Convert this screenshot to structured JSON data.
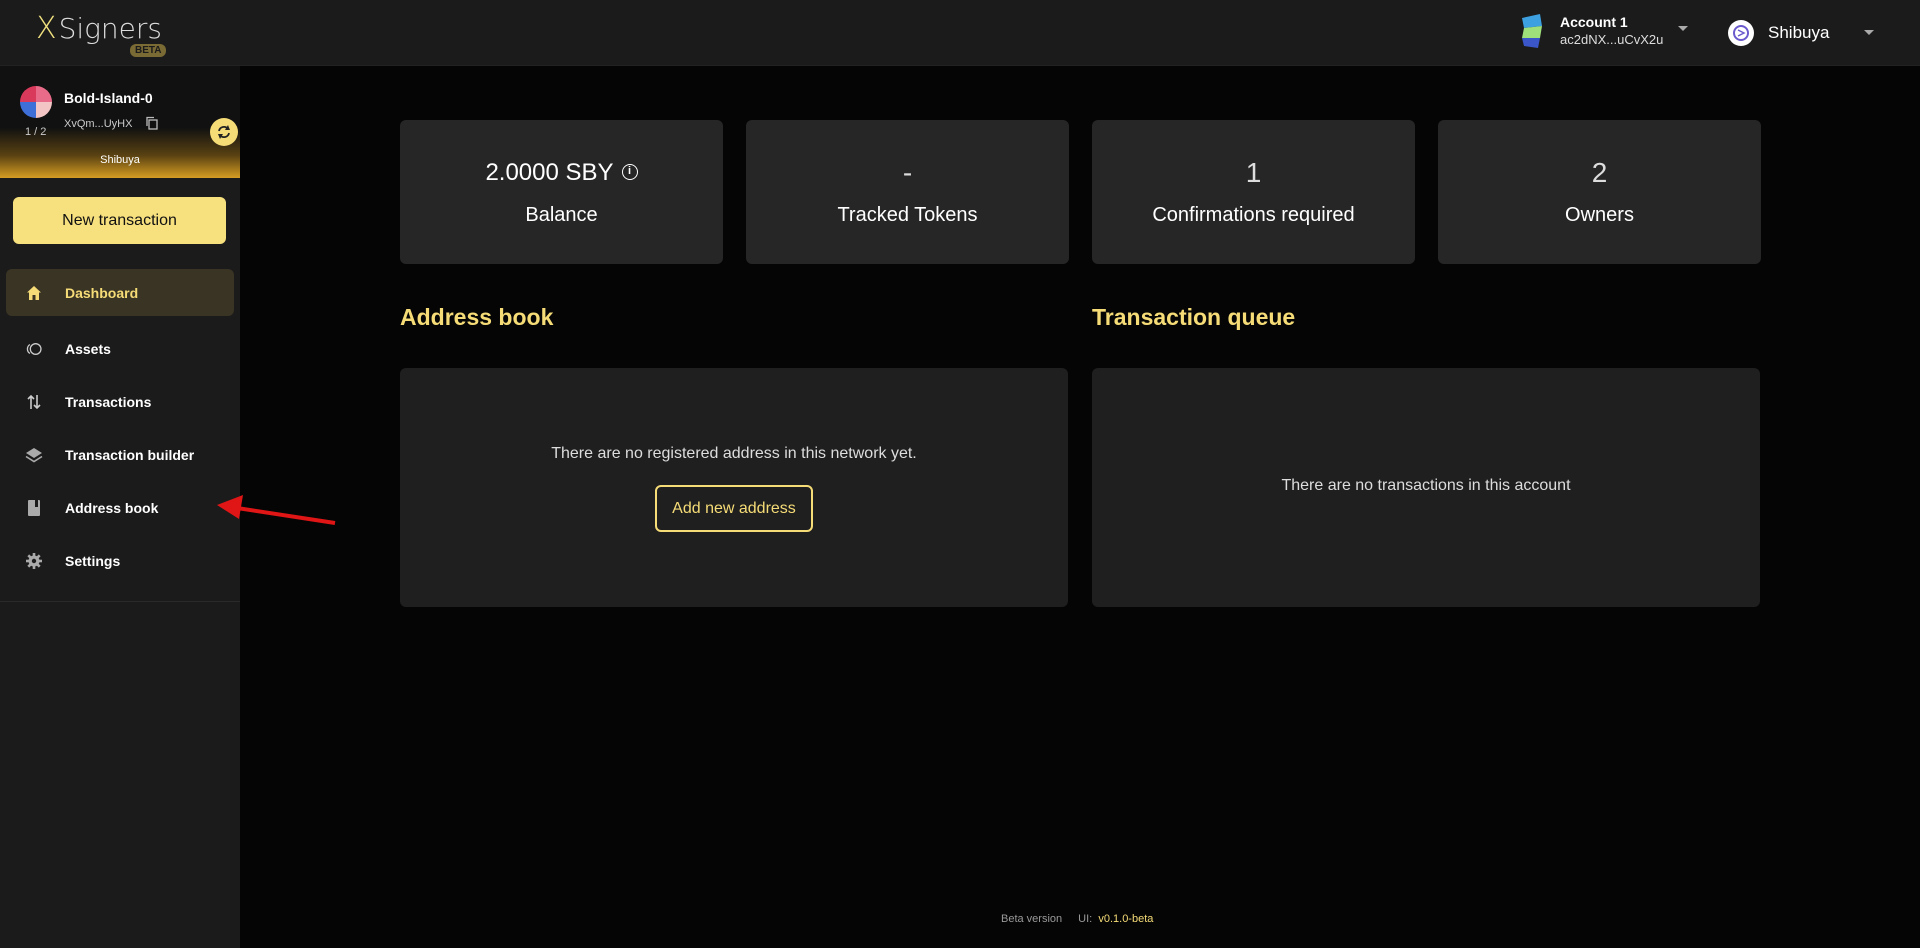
{
  "app": {
    "logo_mark": "X",
    "logo_text": "Signers",
    "logo_badge": "BETA"
  },
  "header": {
    "account_name": "Account 1",
    "account_address": "ac2dNX...uCvX2u",
    "network_name": "Shibuya"
  },
  "safe": {
    "name": "Bold-Island-0",
    "address": "XvQm...UyHX",
    "count": "1 / 2",
    "network": "Shibuya"
  },
  "sidebar": {
    "new_transaction_label": "New transaction",
    "items": [
      {
        "label": "Dashboard",
        "icon": "home-icon",
        "active": true
      },
      {
        "label": "Assets",
        "icon": "coins-icon"
      },
      {
        "label": "Transactions",
        "icon": "arrows-updown-icon"
      },
      {
        "label": "Transaction builder",
        "icon": "layers-icon"
      },
      {
        "label": "Address book",
        "icon": "book-icon"
      },
      {
        "label": "Settings",
        "icon": "gear-icon"
      }
    ]
  },
  "stats": [
    {
      "value": "2.0000 SBY",
      "label": "Balance"
    },
    {
      "value": "-",
      "label": "Tracked Tokens"
    },
    {
      "value": "1",
      "label": "Confirmations required"
    },
    {
      "value": "2",
      "label": "Owners"
    }
  ],
  "address_book": {
    "title": "Address book",
    "empty_text": "There are no registered address in this network yet.",
    "add_label": "Add new address"
  },
  "transaction_queue": {
    "title": "Transaction queue",
    "empty_text": "There are no transactions in this account"
  },
  "footer": {
    "beta_text": "Beta version",
    "ui_label": "UI:",
    "ui_version": "v0.1.0-beta"
  },
  "colors": {
    "accent": "#f6dc77",
    "background": "#050505",
    "sidebar": "#1b1b1b",
    "card": "#262626",
    "annotation": "#e01515"
  }
}
